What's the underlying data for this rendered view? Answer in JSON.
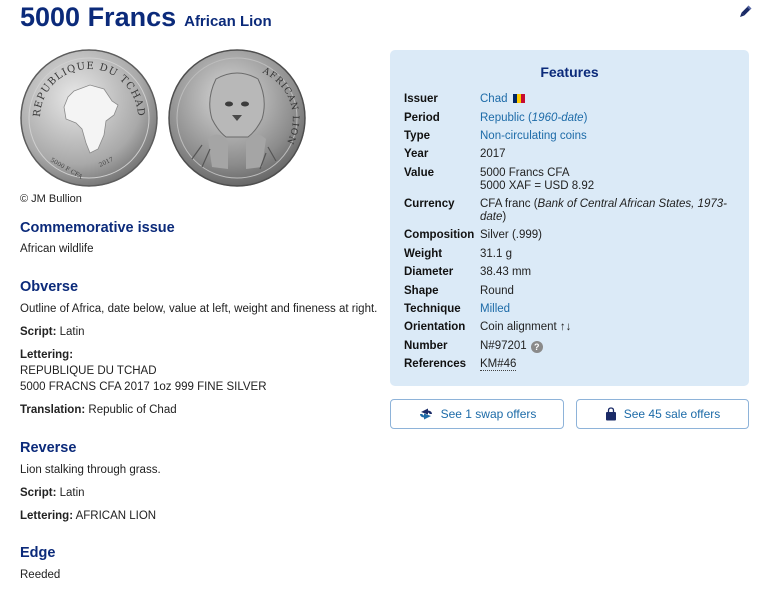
{
  "title": {
    "main": "5000 Francs",
    "sub": "African Lion"
  },
  "icons": {
    "edit": "pencil-icon",
    "swap": "swap-icon",
    "sale": "shopping-bag-icon",
    "help": "question-icon"
  },
  "coins": {
    "obverse_legend": "REPUBLIQUE DU TCHAD",
    "reverse_legend": "AFRICAN LION",
    "credit": "© JM Bullion"
  },
  "commemorative": {
    "title": "Commemorative issue",
    "text": "African wildlife"
  },
  "obverse": {
    "title": "Obverse",
    "description": "Outline of Africa, date below, value at left, weight and fineness at right.",
    "script_label": "Script:",
    "script_value": "Latin",
    "lettering_label": "Lettering:",
    "lettering_line1": "REPUBLIQUE DU TCHAD",
    "lettering_line2": "5000 FRACNS CFA 2017 1oz 999 FINE SILVER",
    "translation_label": "Translation:",
    "translation_value": "Republic of Chad"
  },
  "reverse": {
    "title": "Reverse",
    "description": "Lion stalking through grass.",
    "script_label": "Script:",
    "script_value": "Latin",
    "lettering_label": "Lettering:",
    "lettering_value": "AFRICAN LION"
  },
  "edge": {
    "title": "Edge",
    "text": "Reeded"
  },
  "features": {
    "title": "Features",
    "issuer_label": "Issuer",
    "issuer_value": "Chad",
    "flag_colors": [
      "#002664",
      "#fecb00",
      "#c60c30"
    ],
    "period_label": "Period",
    "period_value": "Republic",
    "period_open": " (",
    "period_italic": "1960-date",
    "period_close": ")",
    "type_label": "Type",
    "type_value": "Non-circulating coins",
    "year_label": "Year",
    "year_value": "2017",
    "value_label": "Value",
    "value_line1": "5000 Francs CFA",
    "value_line2": "5000 XAF = USD 8.92",
    "currency_label": "Currency",
    "currency_value": "CFA franc",
    "currency_open": " (",
    "currency_italic": "Bank of Central African States, 1973-date",
    "currency_close": ")",
    "composition_label": "Composition",
    "composition_value": "Silver (.999)",
    "weight_label": "Weight",
    "weight_value": "31.1 g",
    "diameter_label": "Diameter",
    "diameter_value": "38.43 mm",
    "shape_label": "Shape",
    "shape_value": "Round",
    "technique_label": "Technique",
    "technique_value": "Milled",
    "orientation_label": "Orientation",
    "orientation_value": "Coin alignment ↑↓",
    "number_label": "Number",
    "number_value": "N#97201",
    "references_label": "References",
    "references_value": "KM#46"
  },
  "buttons": {
    "swap": "See 1 swap offers",
    "sale": "See 45 sale offers"
  }
}
